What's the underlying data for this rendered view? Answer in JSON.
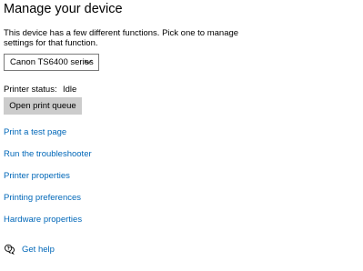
{
  "page": {
    "title": "Manage your device",
    "description": "This device has a few different functions. Pick one to manage settings for that function."
  },
  "device_select": {
    "selected": "Canon TS6400 series"
  },
  "status": {
    "label": "Printer status:",
    "value": "Idle"
  },
  "buttons": {
    "open_queue": "Open print queue"
  },
  "links": {
    "test_page": "Print a test page",
    "troubleshooter": "Run the troubleshooter",
    "printer_properties": "Printer properties",
    "printing_preferences": "Printing preferences",
    "hardware_properties": "Hardware properties"
  },
  "help": {
    "label": "Get help",
    "icon": "chat-help-icon"
  },
  "colors": {
    "link": "#0067b8",
    "button_bg": "#cccccc",
    "border": "#7a7a7a"
  }
}
